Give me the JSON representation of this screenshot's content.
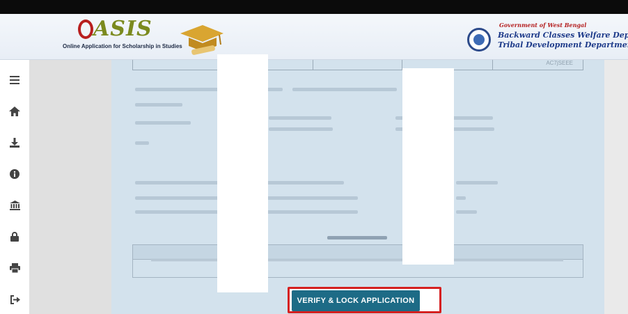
{
  "header": {
    "logo_text": "ASIS",
    "tagline": "Online Application for Scholarship in Studies",
    "gov_line1": "Government of West Bengal",
    "gov_line2": "Backward Classes Welfare Depa",
    "gov_line3": "Tribal Development Department"
  },
  "sidebar": {
    "items": [
      {
        "icon": "menu-icon"
      },
      {
        "icon": "home-icon"
      },
      {
        "icon": "download-icon"
      },
      {
        "icon": "info-icon"
      },
      {
        "icon": "bank-icon"
      },
      {
        "icon": "lock-icon"
      },
      {
        "icon": "print-icon"
      },
      {
        "icon": "logout-icon"
      }
    ]
  },
  "form": {
    "top_table_code": "AC7jSEEE"
  },
  "actions": {
    "verify_label": "VERIFY & LOCK APPLICATION"
  },
  "colors": {
    "primary_button": "#1d6b86",
    "highlight_frame": "#d62020",
    "panel_bg": "#d3e2ed"
  }
}
